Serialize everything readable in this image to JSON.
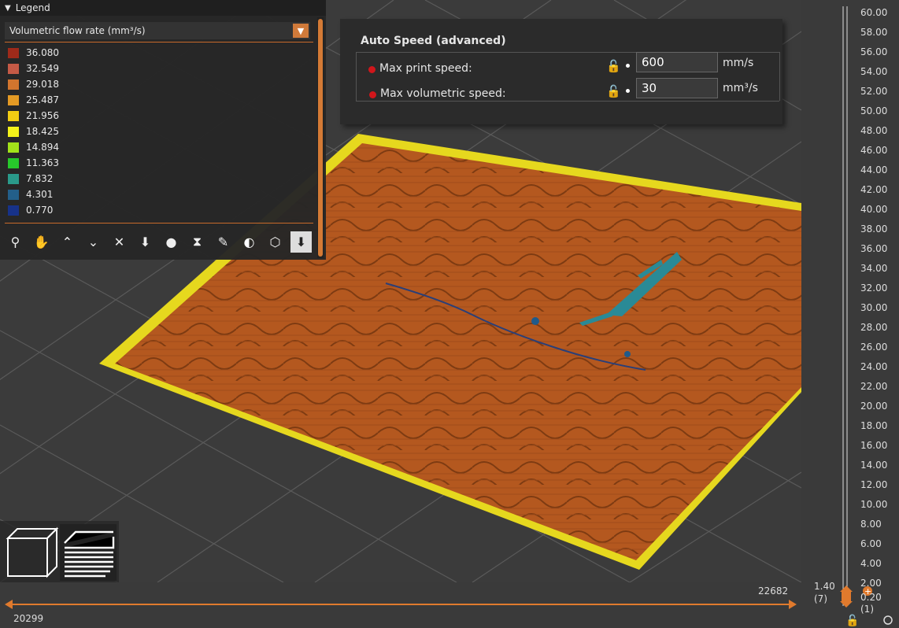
{
  "legend": {
    "title": "Legend",
    "dropdown_value": "Volumetric flow rate (mm³/s)",
    "items": [
      {
        "value": "36.080",
        "color": "#9e2a1a"
      },
      {
        "value": "32.549",
        "color": "#c55a46"
      },
      {
        "value": "29.018",
        "color": "#d2752e"
      },
      {
        "value": "25.487",
        "color": "#e49a24"
      },
      {
        "value": "21.956",
        "color": "#f2cd13"
      },
      {
        "value": "18.425",
        "color": "#f4f21a"
      },
      {
        "value": "14.894",
        "color": "#a2e21a"
      },
      {
        "value": "11.363",
        "color": "#27c82b"
      },
      {
        "value": "7.832",
        "color": "#2a9a8a"
      },
      {
        "value": "4.301",
        "color": "#235f8a"
      },
      {
        "value": "0.770",
        "color": "#173289"
      }
    ],
    "tools": [
      "travel-icon",
      "wipe-icon",
      "retract-icon",
      "deretract-icon",
      "seam-icon",
      "tool-change-icon",
      "color-change-icon",
      "pause-icon",
      "custom-gcode-icon",
      "center-of-gravity-icon",
      "shells-icon",
      "tool-marker-icon"
    ]
  },
  "autospeed": {
    "title": "Auto Speed (advanced)",
    "max_print_speed_label": "Max print speed:",
    "max_print_speed_value": "600",
    "max_print_speed_unit": "mm/s",
    "max_vol_speed_label": "Max volumetric speed:",
    "max_vol_speed_value": "30",
    "max_vol_speed_unit": "mm³/s"
  },
  "vertical_slider": {
    "ticks": [
      "60.00",
      "58.00",
      "56.00",
      "54.00",
      "52.00",
      "50.00",
      "48.00",
      "46.00",
      "44.00",
      "42.00",
      "40.00",
      "38.00",
      "36.00",
      "34.00",
      "32.00",
      "30.00",
      "28.00",
      "26.00",
      "24.00",
      "22.00",
      "20.00",
      "18.00",
      "16.00",
      "14.00",
      "12.00",
      "10.00",
      "8.00",
      "6.00",
      "4.00",
      "2.00"
    ],
    "lower_value": "1.40",
    "lower_layer": "(7)",
    "upper_value": "0.20",
    "upper_layer": "(1)"
  },
  "horizontal_slider": {
    "left_value": "20299",
    "right_value": "22682"
  },
  "colors": {
    "accent": "#e07a2d",
    "plate": "#b55a22",
    "skirt": "#e6d81e"
  }
}
